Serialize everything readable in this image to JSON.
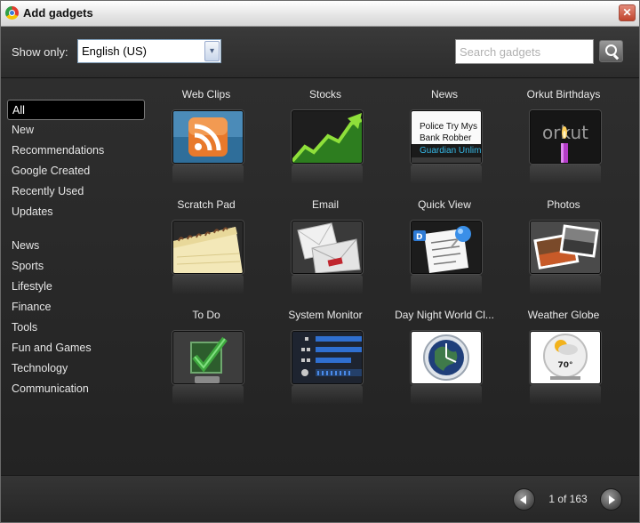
{
  "window": {
    "title": "Add gadgets",
    "close_label": "✕"
  },
  "filter": {
    "show_only_label": "Show only:",
    "language_selected": "English (US)",
    "dropdown_arrow": "▾",
    "search_placeholder": "Search gadgets"
  },
  "sidebar": {
    "group1": [
      "All",
      "New",
      "Recommendations",
      "Google Created",
      "Recently Used",
      "Updates"
    ],
    "group2": [
      "News",
      "Sports",
      "Lifestyle",
      "Finance",
      "Tools",
      "Fun and Games",
      "Technology",
      "Communication"
    ],
    "selected": "All"
  },
  "gadgets": [
    {
      "name": "Web Clips",
      "icon": "rss-icon"
    },
    {
      "name": "Stocks",
      "icon": "stock-chart-icon"
    },
    {
      "name": "News",
      "icon": "news-headline-icon",
      "lines": [
        "Police Try Mys",
        "Bank Robber",
        "Guardian Unlim"
      ]
    },
    {
      "name": "Orkut Birthdays",
      "icon": "orkut-candle-icon",
      "logo_text": "orkut"
    },
    {
      "name": "Scratch Pad",
      "icon": "notepad-icon"
    },
    {
      "name": "Email",
      "icon": "envelope-icon"
    },
    {
      "name": "Quick View",
      "icon": "pinned-doc-icon"
    },
    {
      "name": "Photos",
      "icon": "photos-icon"
    },
    {
      "name": "To Do",
      "icon": "checkmark-icon"
    },
    {
      "name": "System Monitor",
      "icon": "system-monitor-icon"
    },
    {
      "name": "Day Night World Cl...",
      "icon": "world-clock-icon"
    },
    {
      "name": "Weather Globe",
      "icon": "weather-globe-icon",
      "temp": "70°"
    }
  ],
  "pagination": {
    "text": "1 of 163"
  },
  "colors": {
    "background": "#2b2b2b",
    "text": "#e6e6e6",
    "selected_bg": "#000000",
    "accent_blue": "#3a7bd5",
    "check_green": "#3ea73e"
  }
}
